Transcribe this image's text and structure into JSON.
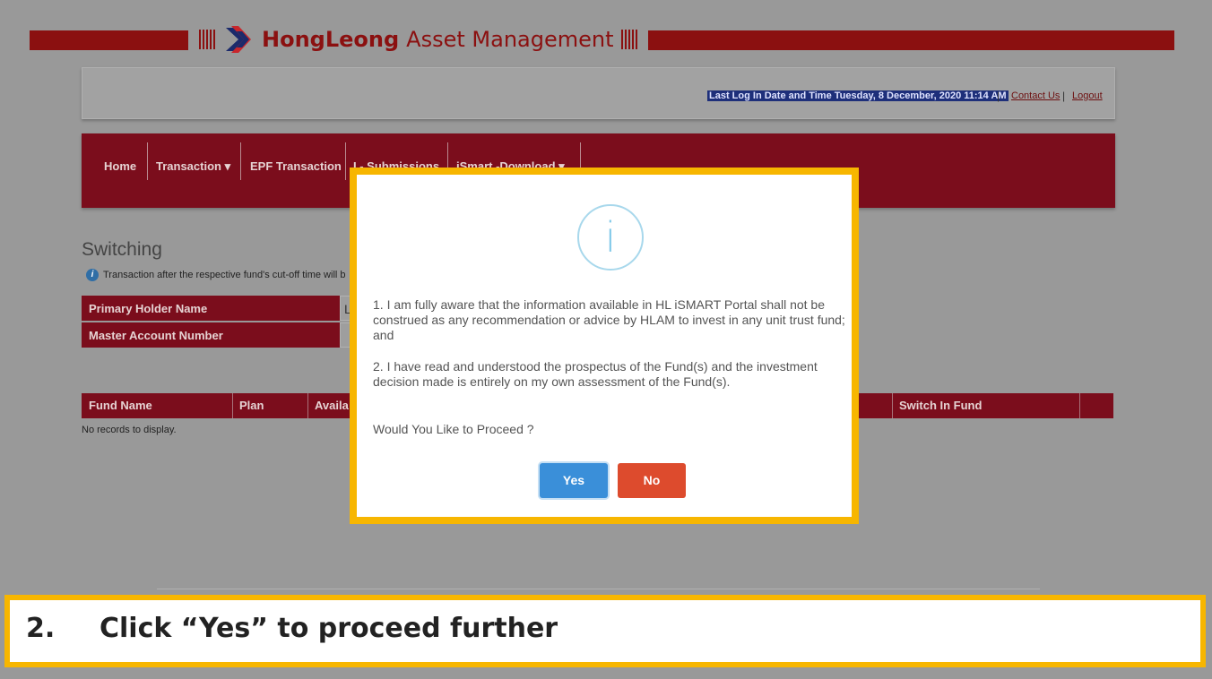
{
  "header": {
    "brand_bold": "HongLeong",
    "brand_light": "Asset Management",
    "accent_color": "#8b1010"
  },
  "topbar": {
    "last_login": "Last Log In Date and Time Tuesday, 8 December, 2020 11:14 AM",
    "contact_us": "Contact Us",
    "logout": "Logout",
    "separator": "|"
  },
  "nav": {
    "items": [
      "Home",
      "Transaction ▾",
      "EPF Transaction",
      "I - Submissions",
      "iSmart -Download ▾"
    ]
  },
  "page": {
    "title": "Switching",
    "notice": "Transaction after the respective fund's cut-off time will b",
    "primary_holder_label": "Primary Holder Name",
    "primary_holder_value": "L",
    "master_account_label": "Master Account Number",
    "fund_table_headers": [
      "Fund Name",
      "Plan",
      "Availa",
      "Switch In Fund"
    ],
    "no_records": "No records to display."
  },
  "modal": {
    "icon": "info-icon",
    "icon_glyph": "i",
    "paragraph1": "1. I am fully aware that the information available in HL iSMART Portal shall not be construed as any recommendation or advice by HLAM to invest in any unit trust fund; and",
    "paragraph2": "2. I have read and understood the prospectus of the Fund(s) and the investment decision made is entirely on my own assessment of the Fund(s).",
    "question": "Would You Like to Proceed ?",
    "yes_label": "Yes",
    "no_label": "No",
    "highlight_color": "#f7b600"
  },
  "caption": {
    "number": "2.",
    "text": "Click “Yes” to proceed further"
  }
}
